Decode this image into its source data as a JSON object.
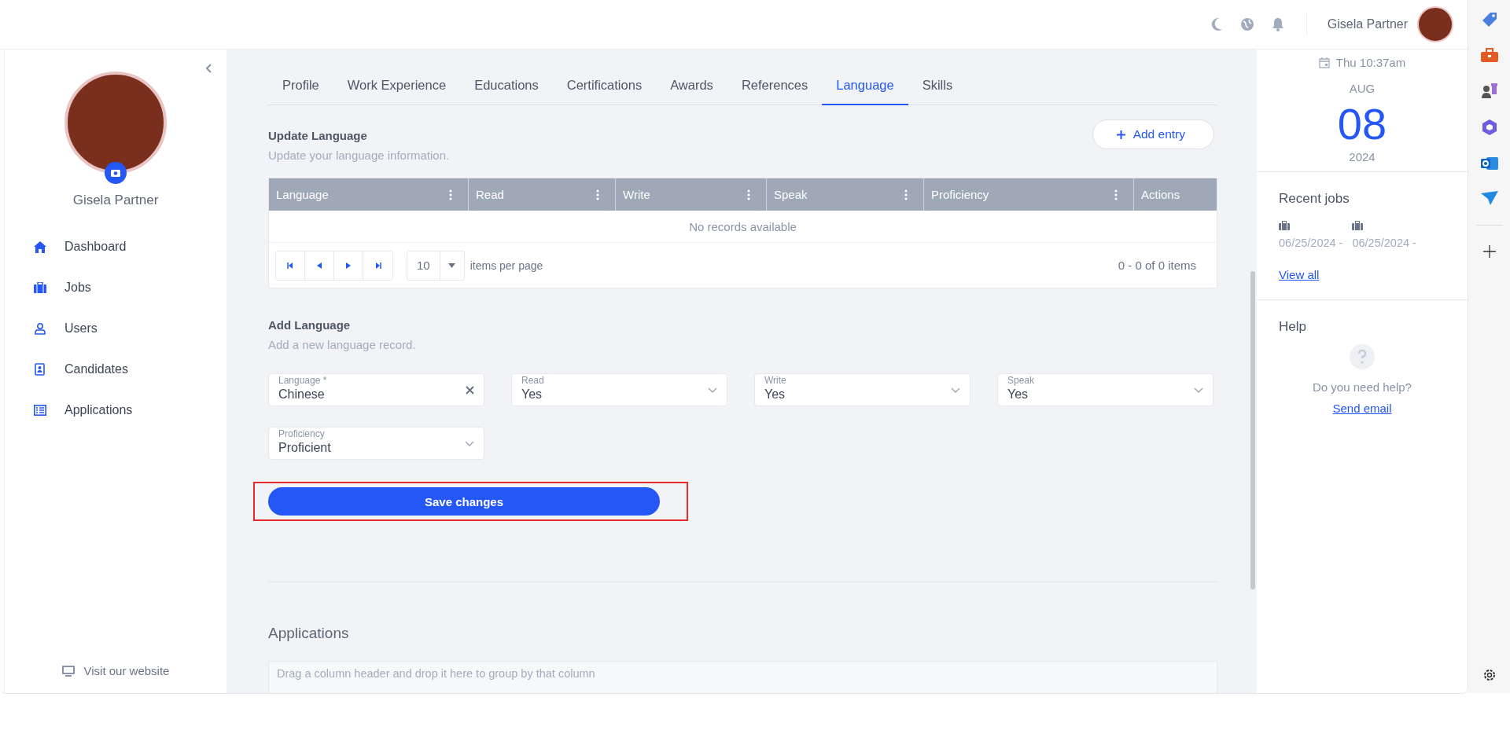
{
  "topbar": {
    "user_name": "Gisela Partner"
  },
  "sidebar": {
    "user_name": "Gisela Partner",
    "nav": [
      {
        "label": "Dashboard",
        "kind": "home"
      },
      {
        "label": "Jobs",
        "kind": "briefcase"
      },
      {
        "label": "Users",
        "kind": "user"
      },
      {
        "label": "Candidates",
        "kind": "contact"
      },
      {
        "label": "Applications",
        "kind": "list"
      }
    ],
    "footer_link": "Visit our website"
  },
  "tabs": [
    {
      "label": "Profile",
      "selected": false
    },
    {
      "label": "Work Experience",
      "selected": false
    },
    {
      "label": "Educations",
      "selected": false
    },
    {
      "label": "Certifications",
      "selected": false
    },
    {
      "label": "Awards",
      "selected": false
    },
    {
      "label": "References",
      "selected": false
    },
    {
      "label": "Language",
      "selected": true
    },
    {
      "label": "Skills",
      "selected": false
    }
  ],
  "update_section": {
    "title": "Update Language",
    "subtitle": "Update your language information.",
    "add_button": "Add entry",
    "table": {
      "columns": [
        {
          "label": "Language",
          "menu": true
        },
        {
          "label": "Read",
          "menu": true
        },
        {
          "label": "Write",
          "menu": true
        },
        {
          "label": "Speak",
          "menu": true
        },
        {
          "label": "Proficiency",
          "menu": true
        },
        {
          "label": "Actions",
          "menu": false
        }
      ],
      "empty_message": "No records available"
    },
    "pager": {
      "page_size": "10",
      "page_size_label": "items per page",
      "summary": "0 - 0 of 0 items"
    }
  },
  "add_section": {
    "title": "Add Language",
    "subtitle": "Add a new language record.",
    "fields": [
      {
        "label": "Language *",
        "value": "Chinese",
        "kind": "text"
      },
      {
        "label": "Read",
        "value": "Yes",
        "kind": "select"
      },
      {
        "label": "Write",
        "value": "Yes",
        "kind": "select"
      },
      {
        "label": "Speak",
        "value": "Yes",
        "kind": "select"
      },
      {
        "label": "Proficiency",
        "value": "Proficient",
        "kind": "select"
      }
    ],
    "save_button": {
      "label": "Save changes",
      "highlighted": true
    }
  },
  "applications": {
    "title": "Applications",
    "group_hint": "Drag a column header and drop it here to group by that column"
  },
  "calendar": {
    "time": "Thu 10:37am",
    "month": "AUG",
    "day": "08",
    "year": "2024"
  },
  "recent_jobs": {
    "title": "Recent jobs",
    "jobs": [
      {
        "date": "06/25/2024 -"
      },
      {
        "date": "06/25/2024 -"
      }
    ],
    "view_all": "View all"
  },
  "help": {
    "title": "Help",
    "question": "Do you need help?",
    "link": "Send email"
  }
}
